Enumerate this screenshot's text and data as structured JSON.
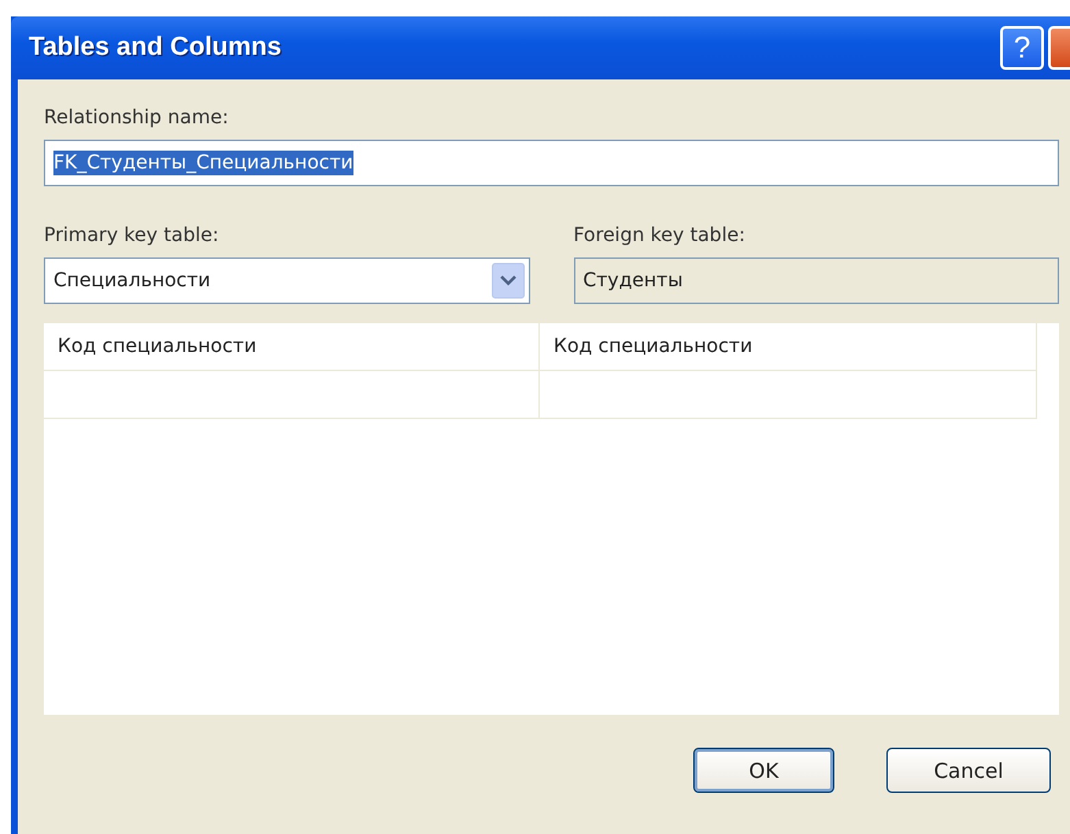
{
  "window": {
    "title": "Tables and Columns",
    "title_buttons": [
      {
        "kind": "help",
        "label": "?"
      },
      {
        "kind": "close"
      }
    ]
  },
  "relationship_name": {
    "label": "Relationship name:",
    "value": "FK_Студенты_Специальности",
    "selected": true
  },
  "primary_key_table": {
    "label": "Primary key table:",
    "value": "Специальности"
  },
  "foreign_key_table": {
    "label": "Foreign key table:",
    "value": "Студенты",
    "disabled": true
  },
  "columns_grid": {
    "rows": [
      [
        "Код специальности",
        "Код специальности"
      ]
    ]
  },
  "buttons": [
    {
      "label": "OK",
      "default": true
    },
    {
      "label": "Cancel",
      "default": false
    }
  ]
}
